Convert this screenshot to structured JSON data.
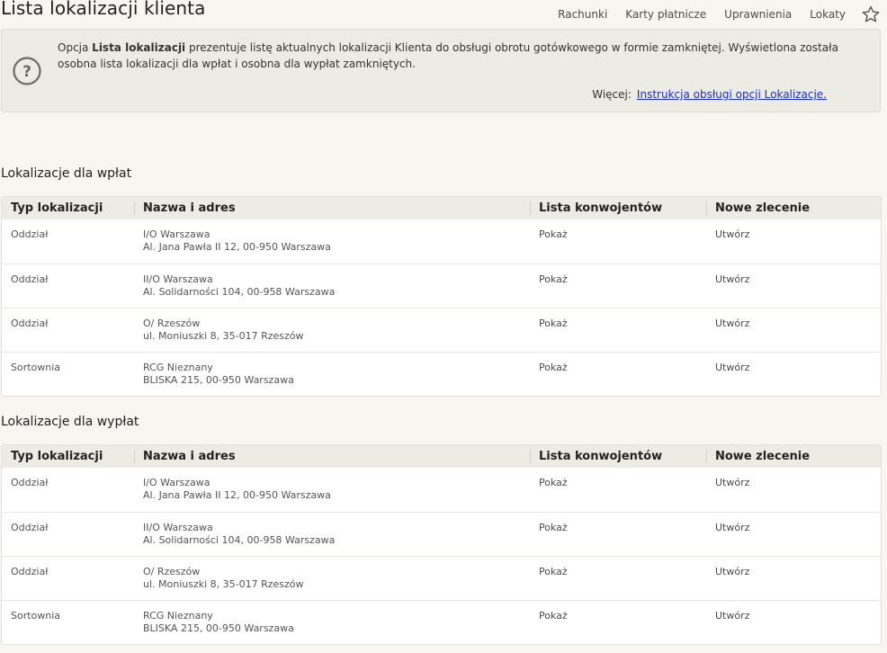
{
  "page": {
    "title": "Lista lokalizacji klienta"
  },
  "topnav": {
    "items": [
      "Rachunki",
      "Karty płatnicze",
      "Uprawnienia",
      "Lokaty"
    ]
  },
  "info": {
    "text_before": "Opcja ",
    "text_bold": "Lista lokalizacji",
    "text_after": " prezentuje listę aktualnych lokalizacji Klienta do obsługi obrotu gotówkowego w formie zamkniętej. Wyświetlona została osobna lista lokalizacji dla wpłat i osobna dla wypłat zamkniętych.",
    "more_label": "Więcej:",
    "more_link": "Instrukcja obsługi opcji Lokalizacje."
  },
  "columns": {
    "type": "Typ lokalizacji",
    "name": "Nazwa i adres",
    "convoy": "Lista konwojentów",
    "order": "Nowe zlecenie"
  },
  "deposits": {
    "title": "Lokalizacje dla wpłat",
    "rows": [
      {
        "type": "Oddział",
        "name": "I/O Warszawa",
        "address": "Al. Jana Pawła II 12, 00-950 Warszawa",
        "convoy": "Pokaż",
        "order": "Utwórz"
      },
      {
        "type": "Oddział",
        "name": "II/O Warszawa",
        "address": "Al. Solidarności 104, 00-958 Warszawa",
        "convoy": "Pokaż",
        "order": "Utwórz"
      },
      {
        "type": "Oddział",
        "name": "O/ Rzeszów",
        "address": "ul. Moniuszki 8, 35-017 Rzeszów",
        "convoy": "Pokaż",
        "order": "Utwórz"
      },
      {
        "type": "Sortownia",
        "name": "RCG Nieznany",
        "address": "BLISKA 215, 00-950 Warszawa",
        "convoy": "Pokaż",
        "order": "Utwórz"
      }
    ]
  },
  "withdrawals": {
    "title": "Lokalizacje dla wypłat",
    "rows": [
      {
        "type": "Oddział",
        "name": "I/O Warszawa",
        "address": "Al. Jana Pawła II 12, 00-950 Warszawa",
        "convoy": "Pokaż",
        "order": "Utwórz"
      },
      {
        "type": "Oddział",
        "name": "II/O Warszawa",
        "address": "Al. Solidarności 104, 00-958 Warszawa",
        "convoy": "Pokaż",
        "order": "Utwórz"
      },
      {
        "type": "Oddział",
        "name": "O/ Rzeszów",
        "address": "ul. Moniuszki 8, 35-017 Rzeszów",
        "convoy": "Pokaż",
        "order": "Utwórz"
      },
      {
        "type": "Sortownia",
        "name": "RCG Nieznany",
        "address": "BLISKA 215, 00-950 Warszawa",
        "convoy": "Pokaż",
        "order": "Utwórz"
      }
    ]
  }
}
